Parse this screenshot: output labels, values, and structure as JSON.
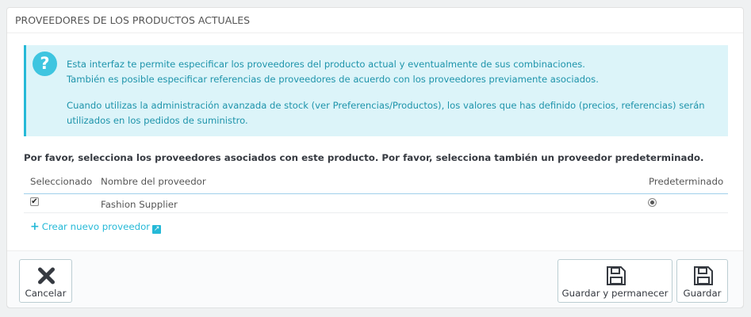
{
  "panel": {
    "title": "PROVEEDORES DE LOS PRODUCTOS ACTUALES"
  },
  "info": {
    "icon": "question-circle-icon",
    "line1": "Esta interfaz te permite especificar los proveedores del producto actual y eventualmente de sus combinaciones.",
    "line2": "También es posible especificar referencias de proveedores de acuerdo con los proveedores previamente asociados.",
    "line3": "Cuando utilizas la administración avanzada de stock (ver Preferencias/Productos), los valores que has definido (precios, referencias) serán",
    "line4": "utilizados en los pedidos de suministro."
  },
  "instructions": "Por favor, selecciona los proveedores asociados con este producto. Por favor, selecciona también un proveedor predeterminado.",
  "table": {
    "columns": [
      "Seleccionado",
      "Nombre del proveedor",
      "Predeterminado"
    ],
    "rows": [
      {
        "selected": true,
        "name": "Fashion Supplier",
        "default": true
      }
    ]
  },
  "create_link": {
    "label": "Crear nuevo proveedor",
    "icon": "external-link-icon"
  },
  "footer": {
    "cancel_label": "Cancelar",
    "save_stay_label": "Guardar y permanecer",
    "save_label": "Guardar"
  },
  "colors": {
    "accent": "#25b9d7",
    "info_bg": "#dcf4f9",
    "info_text": "#1e94ab"
  }
}
